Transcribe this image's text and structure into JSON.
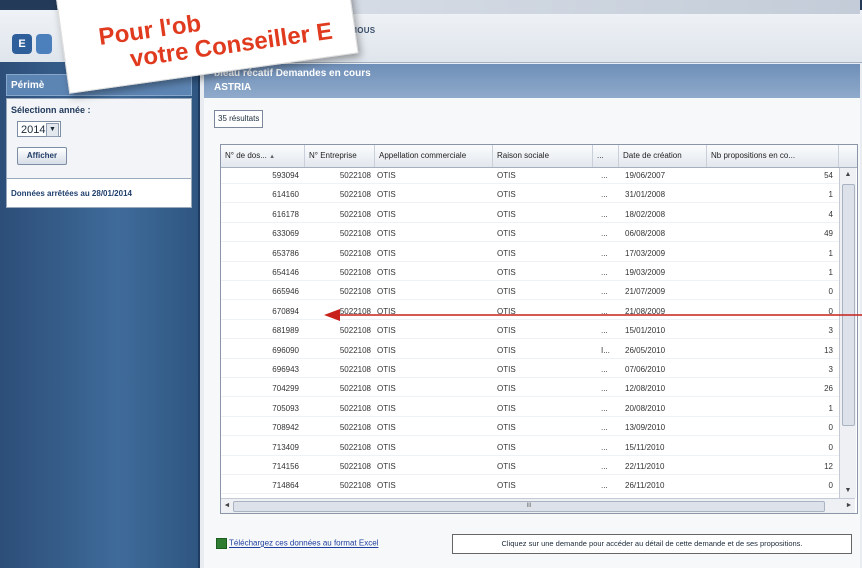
{
  "banner": {
    "line1": "Pour l'ob",
    "line2": "votre Conseiller E"
  },
  "header": {
    "logo_letter": "E",
    "contact_label": "ACTEZ-NOUS"
  },
  "sidebar": {
    "title": "Périmè",
    "select_label": "Sélectionn      année :",
    "year": "2014",
    "button": "Afficher",
    "info": "Données arrêtées au 28/01/2014"
  },
  "main": {
    "title_line1": "bleau récatif Demandes en cours",
    "title_line2": "ASTRIA",
    "count": "35 résultats",
    "columns": [
      "N° de dos...",
      "N° Entreprise",
      "Appellation commerciale",
      "Raison sociale",
      "...",
      "Date de création",
      "Nb propositions en co..."
    ],
    "sort_indicator": "▲",
    "rows": [
      {
        "dossier": "593094",
        "entreprise": "5022108",
        "appellation": "OTIS",
        "raison": "OTIS",
        "extra": "...",
        "date": "19/06/2007",
        "nb": "54"
      },
      {
        "dossier": "614160",
        "entreprise": "5022108",
        "appellation": "OTIS",
        "raison": "OTIS",
        "extra": "...",
        "date": "31/01/2008",
        "nb": "1"
      },
      {
        "dossier": "616178",
        "entreprise": "5022108",
        "appellation": "OTIS",
        "raison": "OTIS",
        "extra": "...",
        "date": "18/02/2008",
        "nb": "4"
      },
      {
        "dossier": "633069",
        "entreprise": "5022108",
        "appellation": "OTIS",
        "raison": "OTIS",
        "extra": "...",
        "date": "06/08/2008",
        "nb": "49"
      },
      {
        "dossier": "653786",
        "entreprise": "5022108",
        "appellation": "OTIS",
        "raison": "OTIS",
        "extra": "...",
        "date": "17/03/2009",
        "nb": "1"
      },
      {
        "dossier": "654146",
        "entreprise": "5022108",
        "appellation": "OTIS",
        "raison": "OTIS",
        "extra": "...",
        "date": "19/03/2009",
        "nb": "1"
      },
      {
        "dossier": "665946",
        "entreprise": "5022108",
        "appellation": "OTIS",
        "raison": "OTIS",
        "extra": "...",
        "date": "21/07/2009",
        "nb": "0"
      },
      {
        "dossier": "670894",
        "entreprise": "5022108",
        "appellation": "OTIS",
        "raison": "OTIS",
        "extra": "...",
        "date": "21/08/2009",
        "nb": "0"
      },
      {
        "dossier": "681989",
        "entreprise": "5022108",
        "appellation": "OTIS",
        "raison": "OTIS",
        "extra": "...",
        "date": "15/01/2010",
        "nb": "3"
      },
      {
        "dossier": "696090",
        "entreprise": "5022108",
        "appellation": "OTIS",
        "raison": "OTIS",
        "extra": "I...",
        "date": "26/05/2010",
        "nb": "13"
      },
      {
        "dossier": "696943",
        "entreprise": "5022108",
        "appellation": "OTIS",
        "raison": "OTIS",
        "extra": "...",
        "date": "07/06/2010",
        "nb": "3"
      },
      {
        "dossier": "704299",
        "entreprise": "5022108",
        "appellation": "OTIS",
        "raison": "OTIS",
        "extra": "...",
        "date": "12/08/2010",
        "nb": "26"
      },
      {
        "dossier": "705093",
        "entreprise": "5022108",
        "appellation": "OTIS",
        "raison": "OTIS",
        "extra": "...",
        "date": "20/08/2010",
        "nb": "1"
      },
      {
        "dossier": "708942",
        "entreprise": "5022108",
        "appellation": "OTIS",
        "raison": "OTIS",
        "extra": "...",
        "date": "13/09/2010",
        "nb": "0"
      },
      {
        "dossier": "713409",
        "entreprise": "5022108",
        "appellation": "OTIS",
        "raison": "OTIS",
        "extra": "...",
        "date": "15/11/2010",
        "nb": "0"
      },
      {
        "dossier": "714156",
        "entreprise": "5022108",
        "appellation": "OTIS",
        "raison": "OTIS",
        "extra": "...",
        "date": "22/11/2010",
        "nb": "12"
      },
      {
        "dossier": "714864",
        "entreprise": "5022108",
        "appellation": "OTIS",
        "raison": "OTIS",
        "extra": "...",
        "date": "26/11/2010",
        "nb": "0"
      }
    ],
    "scroll_mark": "III",
    "excel_link": "Téléchargez ces données au format Excel",
    "hint": "Cliquez sur une demande pour accéder au détail de cette demande et de ses propositions."
  },
  "colors": {
    "accent": "#2f5f9a",
    "annotation": "#e03a1f",
    "sidebar": "#3f6b9a"
  }
}
